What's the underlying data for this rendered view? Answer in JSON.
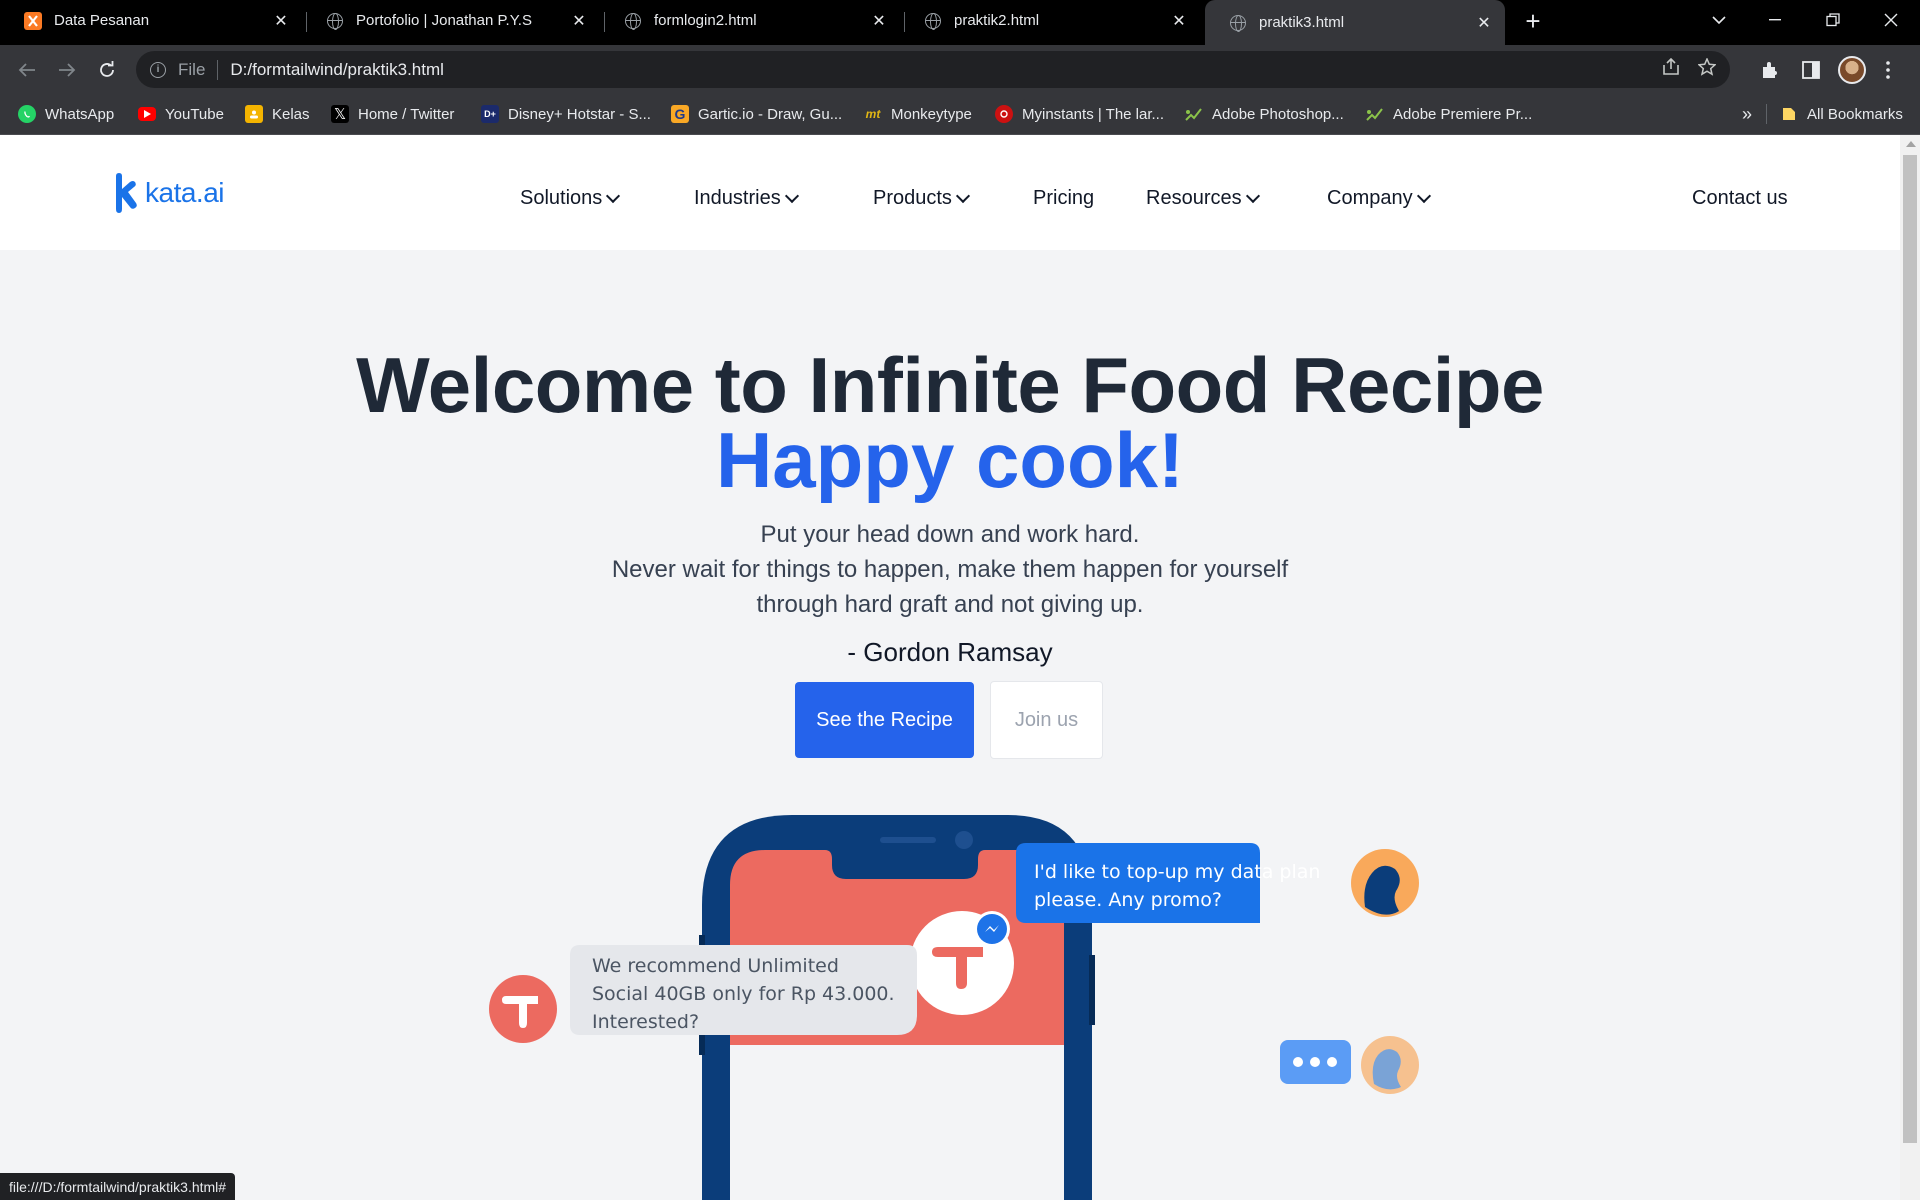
{
  "browser": {
    "tabs": [
      {
        "title": "Data Pesanan",
        "icon": "xampp-icon",
        "active": false
      },
      {
        "title": "Portofolio | Jonathan P.Y.S",
        "icon": "globe-icon",
        "active": false
      },
      {
        "title": "formlogin2.html",
        "icon": "globe-icon",
        "active": false
      },
      {
        "title": "praktik2.html",
        "icon": "globe-icon",
        "active": false
      },
      {
        "title": "praktik3.html",
        "icon": "globe-icon",
        "active": true
      }
    ],
    "address": {
      "scheme": "File",
      "url": "D:/formtailwind/praktik3.html"
    },
    "bookmarks": [
      {
        "label": "WhatsApp",
        "icon": "whatsapp-icon",
        "color": "#25d366"
      },
      {
        "label": "YouTube",
        "icon": "youtube-icon",
        "color": "#ff0000"
      },
      {
        "label": "Kelas",
        "icon": "classroom-icon",
        "color": "#f4b400"
      },
      {
        "label": "Home / Twitter",
        "icon": "x-icon",
        "color": "#000000"
      },
      {
        "label": "Disney+ Hotstar - S...",
        "icon": "hotstar-icon",
        "color": "#1b2a6b"
      },
      {
        "label": "Gartic.io - Draw, Gu...",
        "icon": "gartic-icon",
        "color": "#2b6ff5"
      },
      {
        "label": "Monkeytype",
        "icon": "monkeytype-icon",
        "color": "#e2b714"
      },
      {
        "label": "Myinstants | The lar...",
        "icon": "myinstants-icon",
        "color": "#cc1111"
      },
      {
        "label": "Adobe Photoshop...",
        "icon": "leaf-icon",
        "color": "#8bc34a"
      },
      {
        "label": "Adobe Premiere Pr...",
        "icon": "leaf-icon",
        "color": "#8bc34a"
      }
    ],
    "bookmarks_overflow": "»",
    "all_bookmarks": "All Bookmarks",
    "status_url": "file:///D:/formtailwind/praktik3.html#"
  },
  "site": {
    "logo_text": "kata.ai",
    "brand_color": "#1a73e8",
    "nav": [
      {
        "label": "Solutions",
        "has_dropdown": true
      },
      {
        "label": "Industries",
        "has_dropdown": true
      },
      {
        "label": "Products",
        "has_dropdown": true
      },
      {
        "label": "Pricing",
        "has_dropdown": false
      },
      {
        "label": "Resources",
        "has_dropdown": true
      },
      {
        "label": "Company",
        "has_dropdown": true
      }
    ],
    "contact": "Contact us"
  },
  "hero": {
    "title": "Welcome to Infinite Food Recipe",
    "subtitle": "Happy cook!",
    "quote_lines": [
      "Put your head down and work hard.",
      "Never wait for things to happen, make them happen for yourself",
      "through hard graft and not giving up."
    ],
    "author": "- Gordon Ramsay",
    "primary_button": "See the Recipe",
    "secondary_button": "Join us",
    "accent_color": "#2563eb"
  },
  "illustration": {
    "user_message_lines": [
      "I'd like to top-up my data plan",
      "please. Any promo?"
    ],
    "bot_message_lines": [
      "We recommend Unlimited",
      "Social 40GB only for Rp 43.000.",
      "Interested?"
    ],
    "typing_indicator": "•••"
  }
}
